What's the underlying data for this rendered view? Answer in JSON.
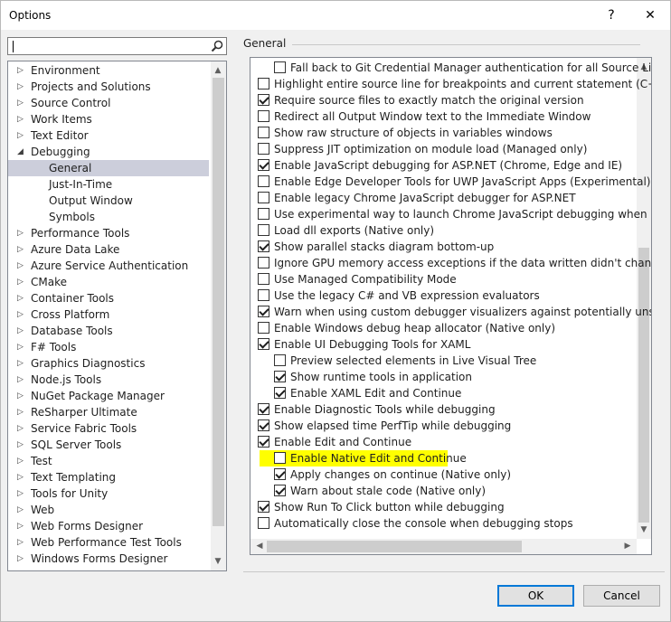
{
  "window": {
    "title": "Options",
    "help_icon": "?",
    "close_icon": "✕"
  },
  "search": {
    "placeholder": ""
  },
  "tree": {
    "items": [
      {
        "label": "Environment",
        "level": 0,
        "arrow": "▷",
        "selected": false
      },
      {
        "label": "Projects and Solutions",
        "level": 0,
        "arrow": "▷",
        "selected": false
      },
      {
        "label": "Source Control",
        "level": 0,
        "arrow": "▷",
        "selected": false
      },
      {
        "label": "Work Items",
        "level": 0,
        "arrow": "▷",
        "selected": false
      },
      {
        "label": "Text Editor",
        "level": 0,
        "arrow": "▷",
        "selected": false
      },
      {
        "label": "Debugging",
        "level": 0,
        "arrow": "◢",
        "selected": false
      },
      {
        "label": "General",
        "level": 1,
        "arrow": "",
        "selected": true
      },
      {
        "label": "Just-In-Time",
        "level": 1,
        "arrow": "",
        "selected": false
      },
      {
        "label": "Output Window",
        "level": 1,
        "arrow": "",
        "selected": false
      },
      {
        "label": "Symbols",
        "level": 1,
        "arrow": "",
        "selected": false
      },
      {
        "label": "Performance Tools",
        "level": 0,
        "arrow": "▷",
        "selected": false
      },
      {
        "label": "Azure Data Lake",
        "level": 0,
        "arrow": "▷",
        "selected": false
      },
      {
        "label": "Azure Service Authentication",
        "level": 0,
        "arrow": "▷",
        "selected": false
      },
      {
        "label": "CMake",
        "level": 0,
        "arrow": "▷",
        "selected": false
      },
      {
        "label": "Container Tools",
        "level": 0,
        "arrow": "▷",
        "selected": false
      },
      {
        "label": "Cross Platform",
        "level": 0,
        "arrow": "▷",
        "selected": false
      },
      {
        "label": "Database Tools",
        "level": 0,
        "arrow": "▷",
        "selected": false
      },
      {
        "label": "F# Tools",
        "level": 0,
        "arrow": "▷",
        "selected": false
      },
      {
        "label": "Graphics Diagnostics",
        "level": 0,
        "arrow": "▷",
        "selected": false
      },
      {
        "label": "Node.js Tools",
        "level": 0,
        "arrow": "▷",
        "selected": false
      },
      {
        "label": "NuGet Package Manager",
        "level": 0,
        "arrow": "▷",
        "selected": false
      },
      {
        "label": "ReSharper Ultimate",
        "level": 0,
        "arrow": "▷",
        "selected": false
      },
      {
        "label": "Service Fabric Tools",
        "level": 0,
        "arrow": "▷",
        "selected": false
      },
      {
        "label": "SQL Server Tools",
        "level": 0,
        "arrow": "▷",
        "selected": false
      },
      {
        "label": "Test",
        "level": 0,
        "arrow": "▷",
        "selected": false
      },
      {
        "label": "Text Templating",
        "level": 0,
        "arrow": "▷",
        "selected": false
      },
      {
        "label": "Tools for Unity",
        "level": 0,
        "arrow": "▷",
        "selected": false
      },
      {
        "label": "Web",
        "level": 0,
        "arrow": "▷",
        "selected": false
      },
      {
        "label": "Web Forms Designer",
        "level": 0,
        "arrow": "▷",
        "selected": false
      },
      {
        "label": "Web Performance Test Tools",
        "level": 0,
        "arrow": "▷",
        "selected": false
      },
      {
        "label": "Windows Forms Designer",
        "level": 0,
        "arrow": "▷",
        "selected": false
      }
    ]
  },
  "page": {
    "title": "General"
  },
  "options": [
    {
      "label": "Fall back to Git Credential Manager authentication for all Source Link requests",
      "checked": false,
      "level": 1
    },
    {
      "label": "Highlight entire source line for breakpoints and current statement (C++ only)",
      "checked": false,
      "level": 0
    },
    {
      "label": "Require source files to exactly match the original version",
      "checked": true,
      "level": 0
    },
    {
      "label": "Redirect all Output Window text to the Immediate Window",
      "checked": false,
      "level": 0
    },
    {
      "label": "Show raw structure of objects in variables windows",
      "checked": false,
      "level": 0
    },
    {
      "label": "Suppress JIT optimization on module load (Managed only)",
      "checked": false,
      "level": 0
    },
    {
      "label": "Enable JavaScript debugging for ASP.NET (Chrome, Edge and IE)",
      "checked": true,
      "level": 0
    },
    {
      "label": "Enable Edge Developer Tools for UWP JavaScript Apps (Experimental)",
      "checked": false,
      "level": 0
    },
    {
      "label": "Enable legacy Chrome JavaScript debugger for ASP.NET",
      "checked": false,
      "level": 0
    },
    {
      "label": "Use experimental way to launch Chrome JavaScript debugging when running",
      "checked": false,
      "level": 0
    },
    {
      "label": "Load dll exports (Native only)",
      "checked": false,
      "level": 0
    },
    {
      "label": "Show parallel stacks diagram bottom-up",
      "checked": true,
      "level": 0
    },
    {
      "label": "Ignore GPU memory access exceptions if the data written didn't change the v",
      "checked": false,
      "level": 0
    },
    {
      "label": "Use Managed Compatibility Mode",
      "checked": false,
      "level": 0
    },
    {
      "label": "Use the legacy C# and VB expression evaluators",
      "checked": false,
      "level": 0
    },
    {
      "label": "Warn when using custom debugger visualizers against potentially unsafe pro",
      "checked": true,
      "level": 0
    },
    {
      "label": "Enable Windows debug heap allocator (Native only)",
      "checked": false,
      "level": 0
    },
    {
      "label": "Enable UI Debugging Tools for XAML",
      "checked": true,
      "level": 0
    },
    {
      "label": "Preview selected elements in Live Visual Tree",
      "checked": false,
      "level": 1
    },
    {
      "label": "Show runtime tools in application",
      "checked": true,
      "level": 1
    },
    {
      "label": "Enable XAML Edit and Continue",
      "checked": true,
      "level": 1
    },
    {
      "label": "Enable Diagnostic Tools while debugging",
      "checked": true,
      "level": 0
    },
    {
      "label": "Show elapsed time PerfTip while debugging",
      "checked": true,
      "level": 0
    },
    {
      "label": "Enable Edit and Continue",
      "checked": true,
      "level": 0
    },
    {
      "label": "Enable Native Edit and Continue",
      "checked": false,
      "level": 1,
      "highlighted": true
    },
    {
      "label": "Apply changes on continue (Native only)",
      "checked": true,
      "level": 1
    },
    {
      "label": "Warn about stale code (Native only)",
      "checked": true,
      "level": 1
    },
    {
      "label": "Show Run To Click button while debugging",
      "checked": true,
      "level": 0
    },
    {
      "label": "Automatically close the console when debugging stops",
      "checked": false,
      "level": 0
    }
  ],
  "buttons": {
    "ok": "OK",
    "cancel": "Cancel"
  },
  "colors": {
    "highlight": "#ffff00",
    "accent": "#0078d7",
    "selection": "#cccedb"
  }
}
